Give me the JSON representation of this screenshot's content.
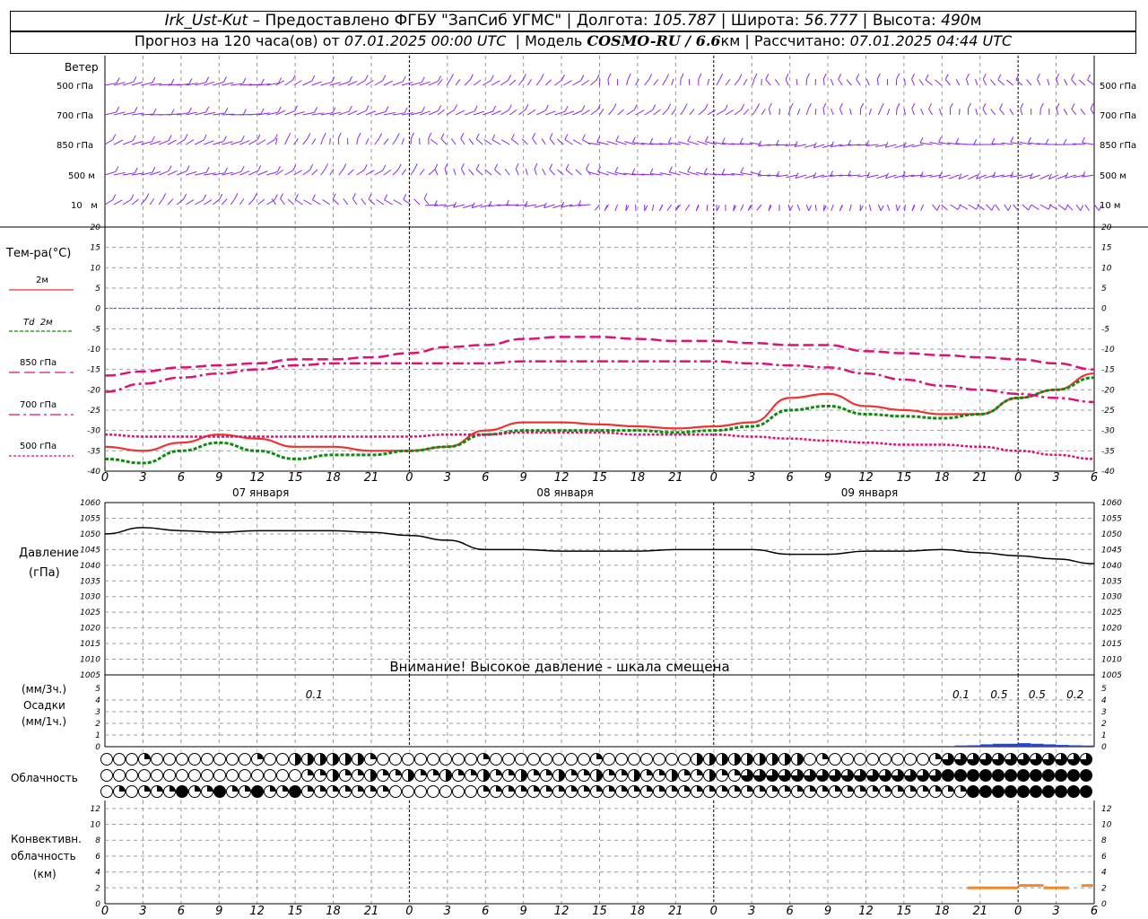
{
  "header": {
    "station": "Irk_Ust-Kut",
    "provider": "–  Предоставлено ФГБУ \"ЗапСиб УГМС\"",
    "lon_label": "Долгота:",
    "lon": "105.787",
    "lat_label": "Широта:",
    "lat": "56.777",
    "alt_label": "Высота:",
    "alt": "490",
    "alt_unit": "м",
    "forecast_label": "Прогноз на 120 часа(ов) от",
    "forecast_start": "07.01.2025 00:00 UTC",
    "model_label": "Модель",
    "model": "COSMO-RU / 6.6",
    "model_unit": "км",
    "calc_label": "Рассчитано:",
    "calc_time": "07.01.2025 04:44 UTC"
  },
  "labels": {
    "wind": "Ветер",
    "wind_levels": [
      "500 гПа",
      "700 гПа",
      "850 гПа",
      "500 м",
      "10   м"
    ],
    "temp_title": "Тем-ра(°C)",
    "legend": [
      "2м",
      "Td  2м",
      "850 гПа",
      "700 гПа",
      "500 гПа"
    ],
    "pressure_title": "Давление",
    "pressure_unit": "(гПа)",
    "pressure_warning": "Внимание! Высокое давление - шкала смещена",
    "precip_3h": "(мм/3ч.)",
    "precip_title": "Осадки",
    "precip_1h": "(мм/1ч.)",
    "cloud_title": "Облачность",
    "conv_title1": "Конвективн.",
    "conv_title2": "облачность",
    "conv_unit": "(км)",
    "dates": [
      "07 января",
      "08 января",
      "09 января"
    ]
  },
  "colors": {
    "wind": "#8a2be2",
    "t2m": "#ee3333",
    "td": "#118811",
    "t850": "#dd1177",
    "t700": "#dd1177",
    "t500": "#dd1177",
    "zero": "#3355ee",
    "pressure": "#000000",
    "precip": "#2244dd",
    "conv": "#ee8833"
  },
  "chart_data": [
    {
      "type": "line",
      "name": "temperature",
      "x_hours": [
        0,
        3,
        6,
        9,
        12,
        15,
        18,
        21,
        24,
        27,
        30,
        33,
        36,
        39,
        42,
        45,
        48,
        51,
        54,
        57,
        60,
        63,
        66,
        69,
        72,
        75,
        78
      ],
      "x_tick_labels": [
        "0",
        "3",
        "6",
        "9",
        "12",
        "15",
        "18",
        "21",
        "0",
        "3",
        "6",
        "9",
        "12",
        "15",
        "18",
        "21",
        "0",
        "3",
        "6",
        "9",
        "12",
        "15",
        "18",
        "21",
        "0",
        "3",
        "6"
      ],
      "ylim": [
        -40,
        20
      ],
      "yticks": [
        -40,
        -35,
        -30,
        -25,
        -20,
        -15,
        -10,
        -5,
        0,
        5,
        10,
        15,
        20
      ],
      "series": [
        {
          "name": "2м",
          "values": [
            -34,
            -35,
            -33,
            -31,
            -32,
            -34,
            -34,
            -35,
            -35,
            -34,
            -30,
            -28,
            -28,
            -28.5,
            -29,
            -29.5,
            -29,
            -28,
            -22,
            -21,
            -24,
            -25,
            -26,
            -26,
            -22,
            -20,
            -16
          ]
        },
        {
          "name": "Td  2м",
          "values": [
            -37,
            -38,
            -35,
            -33,
            -35,
            -37,
            -36,
            -36,
            -35,
            -34,
            -31,
            -30,
            -30,
            -30,
            -30,
            -30.5,
            -30,
            -29,
            -25,
            -24,
            -26,
            -26.5,
            -27,
            -26,
            -22,
            -20,
            -17
          ]
        },
        {
          "name": "850 гПа",
          "values": [
            -16.5,
            -15.5,
            -14.5,
            -14,
            -13.5,
            -12.5,
            -12.5,
            -12,
            -11,
            -9.5,
            -9,
            -7.5,
            -7,
            -7,
            -7.5,
            -8,
            -8,
            -8.5,
            -9,
            -9,
            -10.5,
            -11,
            -11.5,
            -12,
            -12.5,
            -13.5,
            -15
          ]
        },
        {
          "name": "700 гПа",
          "values": [
            -20.5,
            -18.5,
            -17,
            -16,
            -15,
            -14,
            -13.5,
            -13.5,
            -13.5,
            -13.5,
            -13.5,
            -13,
            -13,
            -13,
            -13,
            -13,
            -13,
            -13.5,
            -14,
            -14.5,
            -16,
            -17.5,
            -19,
            -20,
            -21,
            -22,
            -23
          ]
        },
        {
          "name": "500 гПа",
          "values": [
            -31,
            -31.5,
            -31.5,
            -31.5,
            -31.5,
            -31.5,
            -31.5,
            -31.5,
            -31.5,
            -31,
            -31,
            -30.5,
            -30.5,
            -30.5,
            -31,
            -31,
            -31,
            -31.5,
            -32,
            -32.5,
            -33,
            -33.5,
            -33.5,
            -34,
            -35,
            -36,
            -37
          ]
        }
      ]
    },
    {
      "type": "line",
      "name": "pressure",
      "x_hours": [
        0,
        3,
        6,
        9,
        12,
        15,
        18,
        21,
        24,
        27,
        30,
        33,
        36,
        39,
        42,
        45,
        48,
        51,
        54,
        57,
        60,
        63,
        66,
        69,
        72,
        75,
        78
      ],
      "ylim": [
        1005,
        1060
      ],
      "yticks": [
        1005,
        1010,
        1015,
        1020,
        1025,
        1030,
        1035,
        1040,
        1045,
        1050,
        1055,
        1060
      ],
      "series": [
        {
          "name": "Давление",
          "values": [
            1050,
            1052,
            1051,
            1050.5,
            1051,
            1051,
            1051,
            1050.5,
            1049.5,
            1048,
            1045,
            1045,
            1044.5,
            1044.5,
            1044.5,
            1045,
            1045,
            1045,
            1043.5,
            1043.5,
            1044.5,
            1044.5,
            1045,
            1044,
            1043,
            1042,
            1040.5
          ]
        }
      ]
    },
    {
      "type": "bar",
      "name": "precipitation",
      "ylim": [
        0,
        5
      ],
      "yticks": [
        0,
        1,
        2,
        3,
        4,
        5
      ],
      "annotations": [
        {
          "hour": 16.5,
          "text": "0.1"
        },
        {
          "hour": 67.5,
          "text": "0.1"
        },
        {
          "hour": 70.5,
          "text": "0.5"
        },
        {
          "hour": 73.5,
          "text": "0.5"
        },
        {
          "hour": 76.5,
          "text": "0.2"
        }
      ],
      "bars": [
        [
          15,
          15.8,
          0.05
        ],
        [
          67,
          68,
          0.1
        ],
        [
          68,
          69,
          0.12
        ],
        [
          69,
          70,
          0.2
        ],
        [
          70,
          71,
          0.25
        ],
        [
          71,
          72,
          0.25
        ],
        [
          72,
          73,
          0.3
        ],
        [
          73,
          74,
          0.25
        ],
        [
          74,
          75,
          0.2
        ],
        [
          75,
          76,
          0.15
        ],
        [
          76,
          77,
          0.12
        ],
        [
          77,
          78,
          0.1
        ]
      ]
    },
    {
      "type": "line",
      "name": "convective_cloud",
      "ylim": [
        0,
        13
      ],
      "yticks": [
        0,
        2,
        4,
        6,
        8,
        10,
        12
      ],
      "segments": [
        [
          68,
          72,
          2
        ],
        [
          72,
          74,
          2.3
        ],
        [
          74,
          76,
          2
        ],
        [
          77,
          78,
          2.3
        ]
      ]
    }
  ]
}
